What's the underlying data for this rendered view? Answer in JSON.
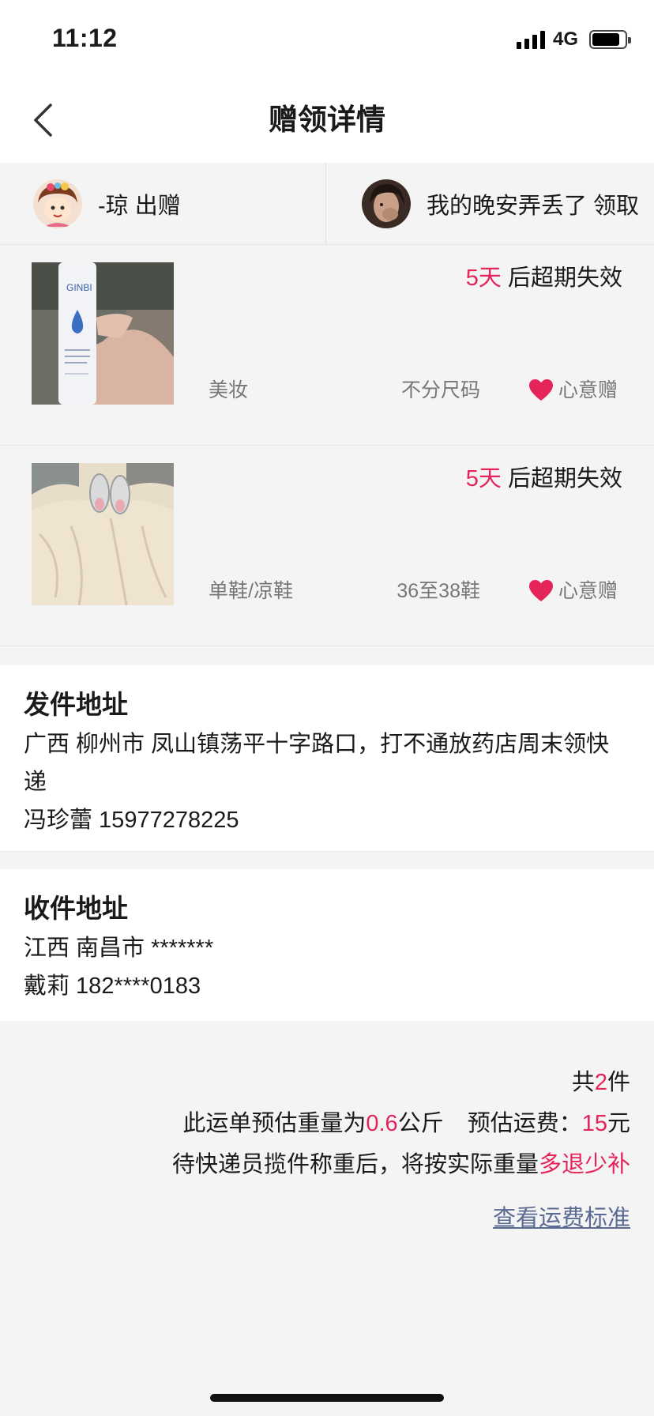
{
  "status_bar": {
    "time": "11:12",
    "network": "4G",
    "battery_level": 0.85
  },
  "nav": {
    "title": "赠领详情",
    "back_icon": "chevron-left-icon"
  },
  "parties": {
    "giver": {
      "text": "-琼 出赠",
      "avatar": "cartoon-girl-avatar"
    },
    "receiver": {
      "text": "我的晚安弄丢了 领取",
      "avatar": "photo-avatar"
    }
  },
  "items": [
    {
      "expiry_days": "5天",
      "expiry_suffix": " 后超期失效",
      "category": "美妆",
      "size": "不分尺码",
      "tag": "心意赠",
      "photo": "spray-bottle-photo"
    },
    {
      "expiry_days": "5天",
      "expiry_suffix": " 后超期失效",
      "category": "单鞋/凉鞋",
      "size": "36至38鞋",
      "tag": "心意赠",
      "photo": "shoes-photo"
    }
  ],
  "sender": {
    "title": "发件地址",
    "address_line1": "广西 柳州市 凤山镇荡平十字路口，打不通放药店周末领快",
    "address_line2": "递",
    "contact": "冯珍蕾 15977278225"
  },
  "receiver": {
    "title": "收件地址",
    "address": "江西 南昌市 *******",
    "contact": "戴莉 182****0183"
  },
  "summary": {
    "count_prefix": "共",
    "count": "2",
    "count_suffix": "件",
    "weight_prefix": "此运单预估重量为",
    "weight": "0.6",
    "weight_unit": "公斤",
    "fee_label": "预估运费：",
    "fee": "15",
    "fee_unit": "元",
    "note_prefix": "待快递员揽件称重后，将按实际重量",
    "note_accent": "多退少补",
    "fee_link": "查看运费标准"
  },
  "colors": {
    "accent": "#e5245a",
    "link": "#5a6a92",
    "background": "#f4f4f4"
  }
}
